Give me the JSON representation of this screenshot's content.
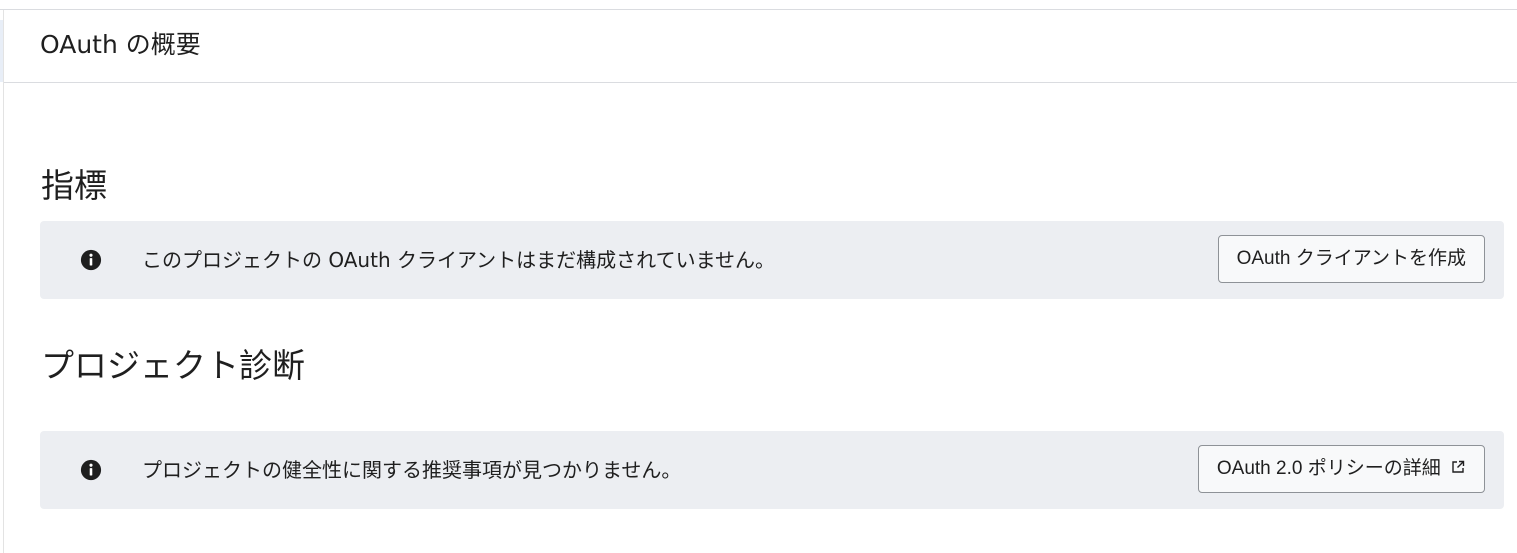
{
  "header": {
    "title": "OAuth の概要"
  },
  "metrics": {
    "title": "指標",
    "message": "このプロジェクトの OAuth クライアントはまだ構成されていません。",
    "button_label": "OAuth クライアントを作成",
    "icon": "info-icon"
  },
  "diagnostics": {
    "title": "プロジェクト診断",
    "message": "プロジェクトの健全性に関する推奨事項が見つかりません。",
    "button_label": "OAuth 2.0 ポリシーの詳細",
    "icon": "info-icon",
    "button_icon": "external-link-icon"
  },
  "colors": {
    "banner_bg": "#eceef2",
    "text": "#1f1f1f",
    "divider": "#dadce0"
  }
}
